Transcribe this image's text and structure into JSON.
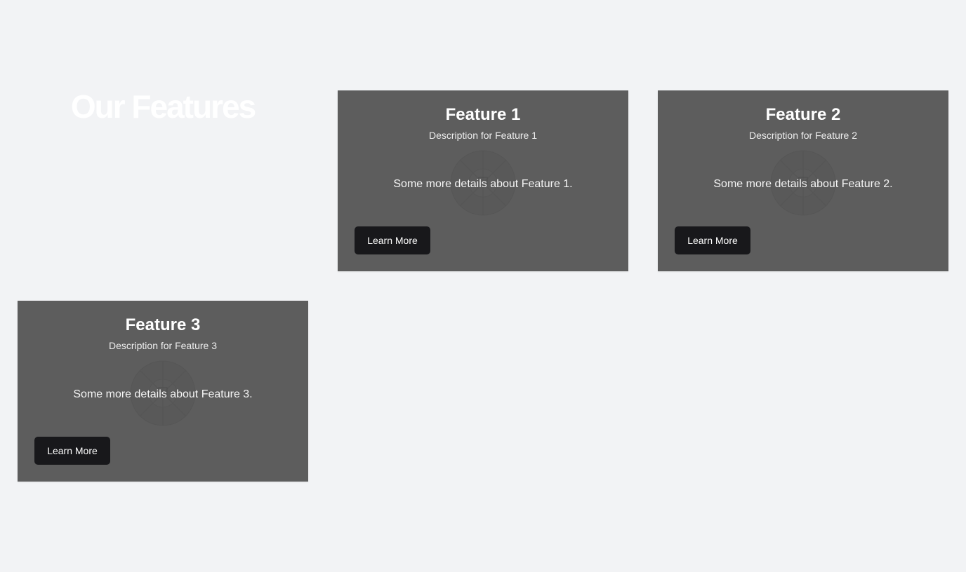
{
  "section": {
    "title": "Our Features"
  },
  "cards": [
    {
      "title": "Feature 1",
      "description": "Description for Feature 1",
      "details": "Some more details about Feature 1.",
      "button_label": "Learn More"
    },
    {
      "title": "Feature 2",
      "description": "Description for Feature 2",
      "details": "Some more details about Feature 2.",
      "button_label": "Learn More"
    },
    {
      "title": "Feature 3",
      "description": "Description for Feature 3",
      "details": "Some more details about Feature 3.",
      "button_label": "Learn More"
    }
  ],
  "colors": {
    "page_background": "#f2f3f5",
    "card_background": "#5d5d5d",
    "button_background": "#18181b",
    "heading_text": "#ffffff"
  },
  "icons": {
    "card_background_graphic": "feature-wheel-icon"
  }
}
